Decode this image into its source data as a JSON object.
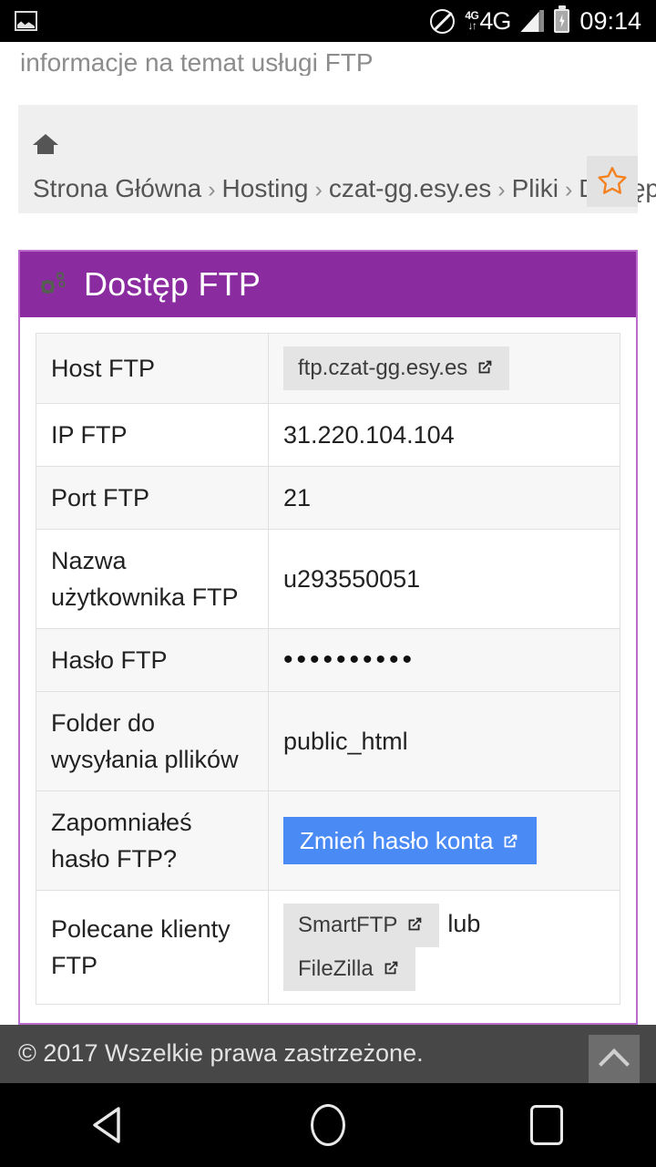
{
  "statusbar": {
    "notification_icon": "photo-icon",
    "icons": [
      "no-entry-icon",
      "4g-data-icon",
      "signal-icon",
      "battery-charging-icon"
    ],
    "network_label": "4G",
    "network_small_label": "4G",
    "clock": "09:14"
  },
  "page": {
    "lead_text": "informacje na temat usługi FTP"
  },
  "breadcrumb": {
    "home_icon": "home-icon",
    "separator": "›",
    "items": [
      {
        "label": "Strona Główna"
      },
      {
        "label": "Hosting"
      },
      {
        "label": "czat-gg.esy.es"
      },
      {
        "label": "Pliki"
      },
      {
        "label": "Dostęp FTP"
      }
    ],
    "bookmark_icon": "star-icon",
    "bookmark_color": "#f58220"
  },
  "panel": {
    "icon": "gears-icon",
    "title": "Dostęp FTP",
    "header_color": "#8a2ba0",
    "border_color": "#bc6ccd",
    "rows": [
      {
        "label": "Host FTP",
        "value_type": "pill",
        "value": "ftp.czat-gg.esy.es",
        "has_external_icon": true
      },
      {
        "label": "IP FTP",
        "value_type": "text",
        "value": "31.220.104.104"
      },
      {
        "label": "Port FTP",
        "value_type": "text",
        "value": "21"
      },
      {
        "label": "Nazwa użytkownika FTP",
        "value_type": "text",
        "value": "u293550051"
      },
      {
        "label": "Hasło FTP",
        "value_type": "password",
        "value": "••••••••••"
      },
      {
        "label": "Folder do wysyłania pllików",
        "value_type": "text",
        "value": "public_html"
      },
      {
        "label": "Zapomniałeś hasło FTP?",
        "value_type": "button",
        "value": "Zmień hasło konta",
        "button_color": "#4a8af4",
        "has_external_icon": true
      },
      {
        "label": "Polecane klienty FTP",
        "value_type": "pill_pair",
        "value": "SmartFTP",
        "value2": "FileZilla",
        "separator_text": "lub",
        "has_external_icon": true
      }
    ]
  },
  "footer": {
    "copyright": "© 2017 Wszelkie prawa zastrzeżone.",
    "to_top_icon": "chevron-up-icon"
  },
  "navbar": {
    "back": "back-triangle-icon",
    "home": "home-circle-icon",
    "recent": "recent-square-icon"
  }
}
